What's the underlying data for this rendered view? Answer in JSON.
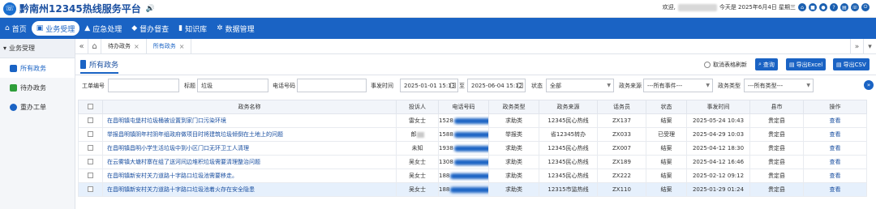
{
  "app": {
    "title": "黔南州12345热线服务平台"
  },
  "header": {
    "welcome": "欢迎,",
    "date": "今天是 2025年6月4日 星期三"
  },
  "nav": [
    {
      "label": "首页",
      "icon": "home-icon"
    },
    {
      "label": "业务受理",
      "icon": "briefcase-icon"
    },
    {
      "label": "应急处理",
      "icon": "alert-icon"
    },
    {
      "label": "督办督查",
      "icon": "shield-icon"
    },
    {
      "label": "知识库",
      "icon": "book-icon"
    },
    {
      "label": "数据管理",
      "icon": "gear-icon"
    }
  ],
  "sidebar": {
    "heading": "业务受理",
    "items": [
      {
        "label": "所有政务",
        "color": "#1a63c4"
      },
      {
        "label": "待办政务",
        "color": "#2e9e3a"
      },
      {
        "label": "重办工单",
        "color": "#1a63c4"
      }
    ]
  },
  "tabs": [
    {
      "label": "待办政务"
    },
    {
      "label": "所有政务"
    }
  ],
  "section": {
    "title": "所有政务",
    "refresh_label": "取消表格刷新",
    "buttons": {
      "query": "查询",
      "export_excel": "导出Excel",
      "export_csv": "导出CSV"
    }
  },
  "filters": {
    "order_no_label": "工单编号",
    "title_label": "标题",
    "title_value": "垃圾",
    "phone_label": "电话号码",
    "time_label": "事发时间",
    "time_from": "2025-01-01 15:13",
    "time_sep": "至",
    "time_to": "2025-06-04 15:12",
    "status_label": "状态",
    "status_value": "全部",
    "source_label": "政务来源",
    "source_value": "---所有事件---",
    "type_label": "政务类型",
    "type_value": "---所有类型---"
  },
  "table": {
    "headers": [
      "政务名称",
      "投诉人",
      "电话号码",
      "政务类型",
      "政务来源",
      "话务员",
      "状态",
      "事发时间",
      "县市",
      "操作"
    ],
    "rows": [
      {
        "title": "在昌明镇屯堡村垃圾桶被设置到家门口污染环境",
        "person": "雷女士",
        "phone": "1528",
        "type": "求助类",
        "source": "12345民心热线",
        "agent": "ZX137",
        "status": "结案",
        "time": "2025-05-24 10:43",
        "county": "贵定县",
        "action": "查看"
      },
      {
        "title": "举报昌明镇阴年村阴年组政府做项目时将建筑垃圾倾倒在土地上的问题",
        "person": "郎",
        "phone": "1588",
        "type": "举报类",
        "source": "省12345转办",
        "agent": "ZX033",
        "status": "已受理",
        "time": "2025-04-29 10:03",
        "county": "贵定县",
        "action": "查看"
      },
      {
        "title": "在昌明镇昌明小学生活垃圾中到小区门口无环卫工人清理",
        "person": "未知",
        "phone": "1938",
        "type": "求助类",
        "source": "12345民心热线",
        "agent": "ZX007",
        "status": "结案",
        "time": "2025-04-12 18:30",
        "county": "贵定县",
        "action": "查看"
      },
      {
        "title": "在云雾镇大塘村寨在组了送河间边堆积垃圾需要清理整治问题",
        "person": "吴女士",
        "phone": "1308",
        "type": "求助类",
        "source": "12345民心热线",
        "agent": "ZX189",
        "status": "结案",
        "time": "2025-04-12 16:46",
        "county": "贵定县",
        "action": "查看"
      },
      {
        "title": "在昌明镇新安村关力道路十字路口垃圾池需要移走。",
        "person": "吴女士",
        "phone": "188",
        "type": "求助类",
        "source": "12345民心热线",
        "agent": "ZX222",
        "status": "结案",
        "time": "2025-02-12 09:12",
        "county": "贵定县",
        "action": "查看"
      },
      {
        "title": "在昌明镇新安村关力道路十字路口垃圾池着火存在安全隐患",
        "person": "吴女士",
        "phone": "188",
        "type": "求助类",
        "source": "12315市监热线",
        "agent": "ZX110",
        "status": "结案",
        "time": "2025-01-29 01:24",
        "county": "贵定县",
        "action": "查看"
      }
    ]
  },
  "colors": {
    "primary": "#1a63c4",
    "title_blue": "#1a4fa0"
  }
}
